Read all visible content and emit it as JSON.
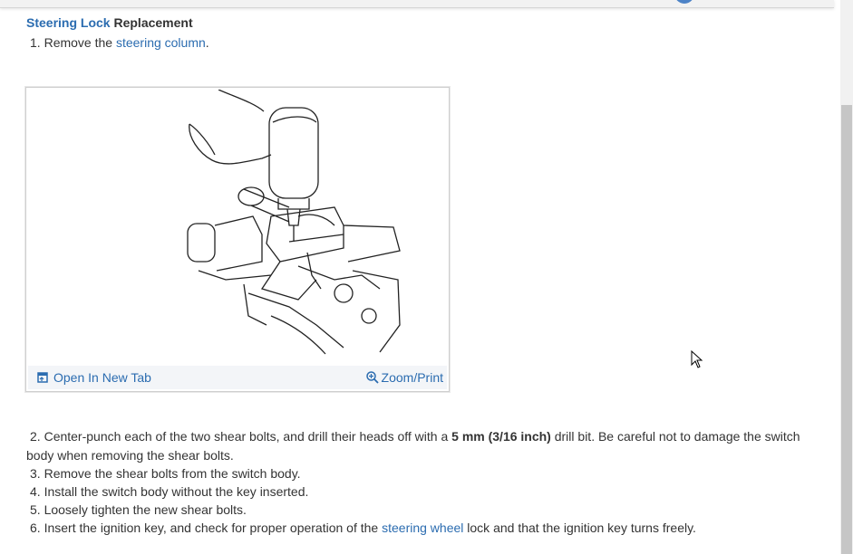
{
  "heading": {
    "link_part": "Steering Lock",
    "text_part": " Replacement"
  },
  "steps": [
    {
      "num": "1.",
      "text": "Remove the ",
      "link": "steering column",
      "after": "."
    },
    {
      "num": "2.",
      "text": "Center-punch each of the two shear bolts, and drill their heads off with a ",
      "bold": "5 mm (3/16 inch)",
      "after": " drill bit. Be careful not to damage the switch body when removing the shear bolts."
    },
    {
      "num": "3.",
      "text": "Remove the shear bolts from the switch body."
    },
    {
      "num": "4.",
      "text": "Install the switch body without the key inserted."
    },
    {
      "num": "5.",
      "text": "Loosely tighten the new shear bolts."
    },
    {
      "num": "6.",
      "text": "Insert the ignition key, and check for proper operation of the ",
      "link": "steering wheel",
      "after": " lock and that the ignition key turns freely."
    }
  ],
  "figure": {
    "open_tab_label": "Open In New Tab",
    "zoom_label": "Zoom/Print"
  },
  "colors": {
    "link": "#2b6cb0",
    "text": "#333333"
  }
}
